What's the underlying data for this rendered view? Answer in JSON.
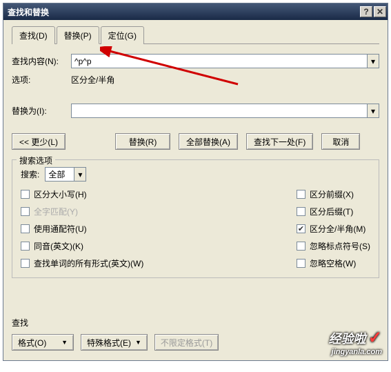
{
  "title": "查找和替换",
  "tabs": {
    "find": "查找(D)",
    "replace": "替换(P)",
    "goto": "定位(G)"
  },
  "labels": {
    "findwhat": "查找内容(N):",
    "options": "选项:",
    "options_value": "区分全/半角",
    "replacewith": "替换为(I):"
  },
  "inputs": {
    "findvalue": "^p^p",
    "replacevalue": ""
  },
  "buttons": {
    "less": "<< 更少(L)",
    "replace": "替换(R)",
    "replaceall": "全部替换(A)",
    "findnext": "查找下一处(F)",
    "cancel": "取消"
  },
  "search": {
    "legend": "搜索选项",
    "label": "搜索:",
    "value": "全部"
  },
  "checks": {
    "matchcase": "区分大小写(H)",
    "wholeword": "全字匹配(Y)",
    "wildcards": "使用通配符(U)",
    "soundslike": "同音(英文)(K)",
    "allforms": "查找单词的所有形式(英文)(W)",
    "prefix": "区分前缀(X)",
    "suffix": "区分后缀(T)",
    "fullhalf": "区分全/半角(M)",
    "punct": "忽略标点符号(S)",
    "space": "忽略空格(W)"
  },
  "findsec": {
    "legend": "查找",
    "format": "格式(O)",
    "special": "特殊格式(E)",
    "noformat": "不限定格式(T)"
  },
  "watermark": {
    "big": "经验啦",
    "small": "jingyanla.com"
  }
}
